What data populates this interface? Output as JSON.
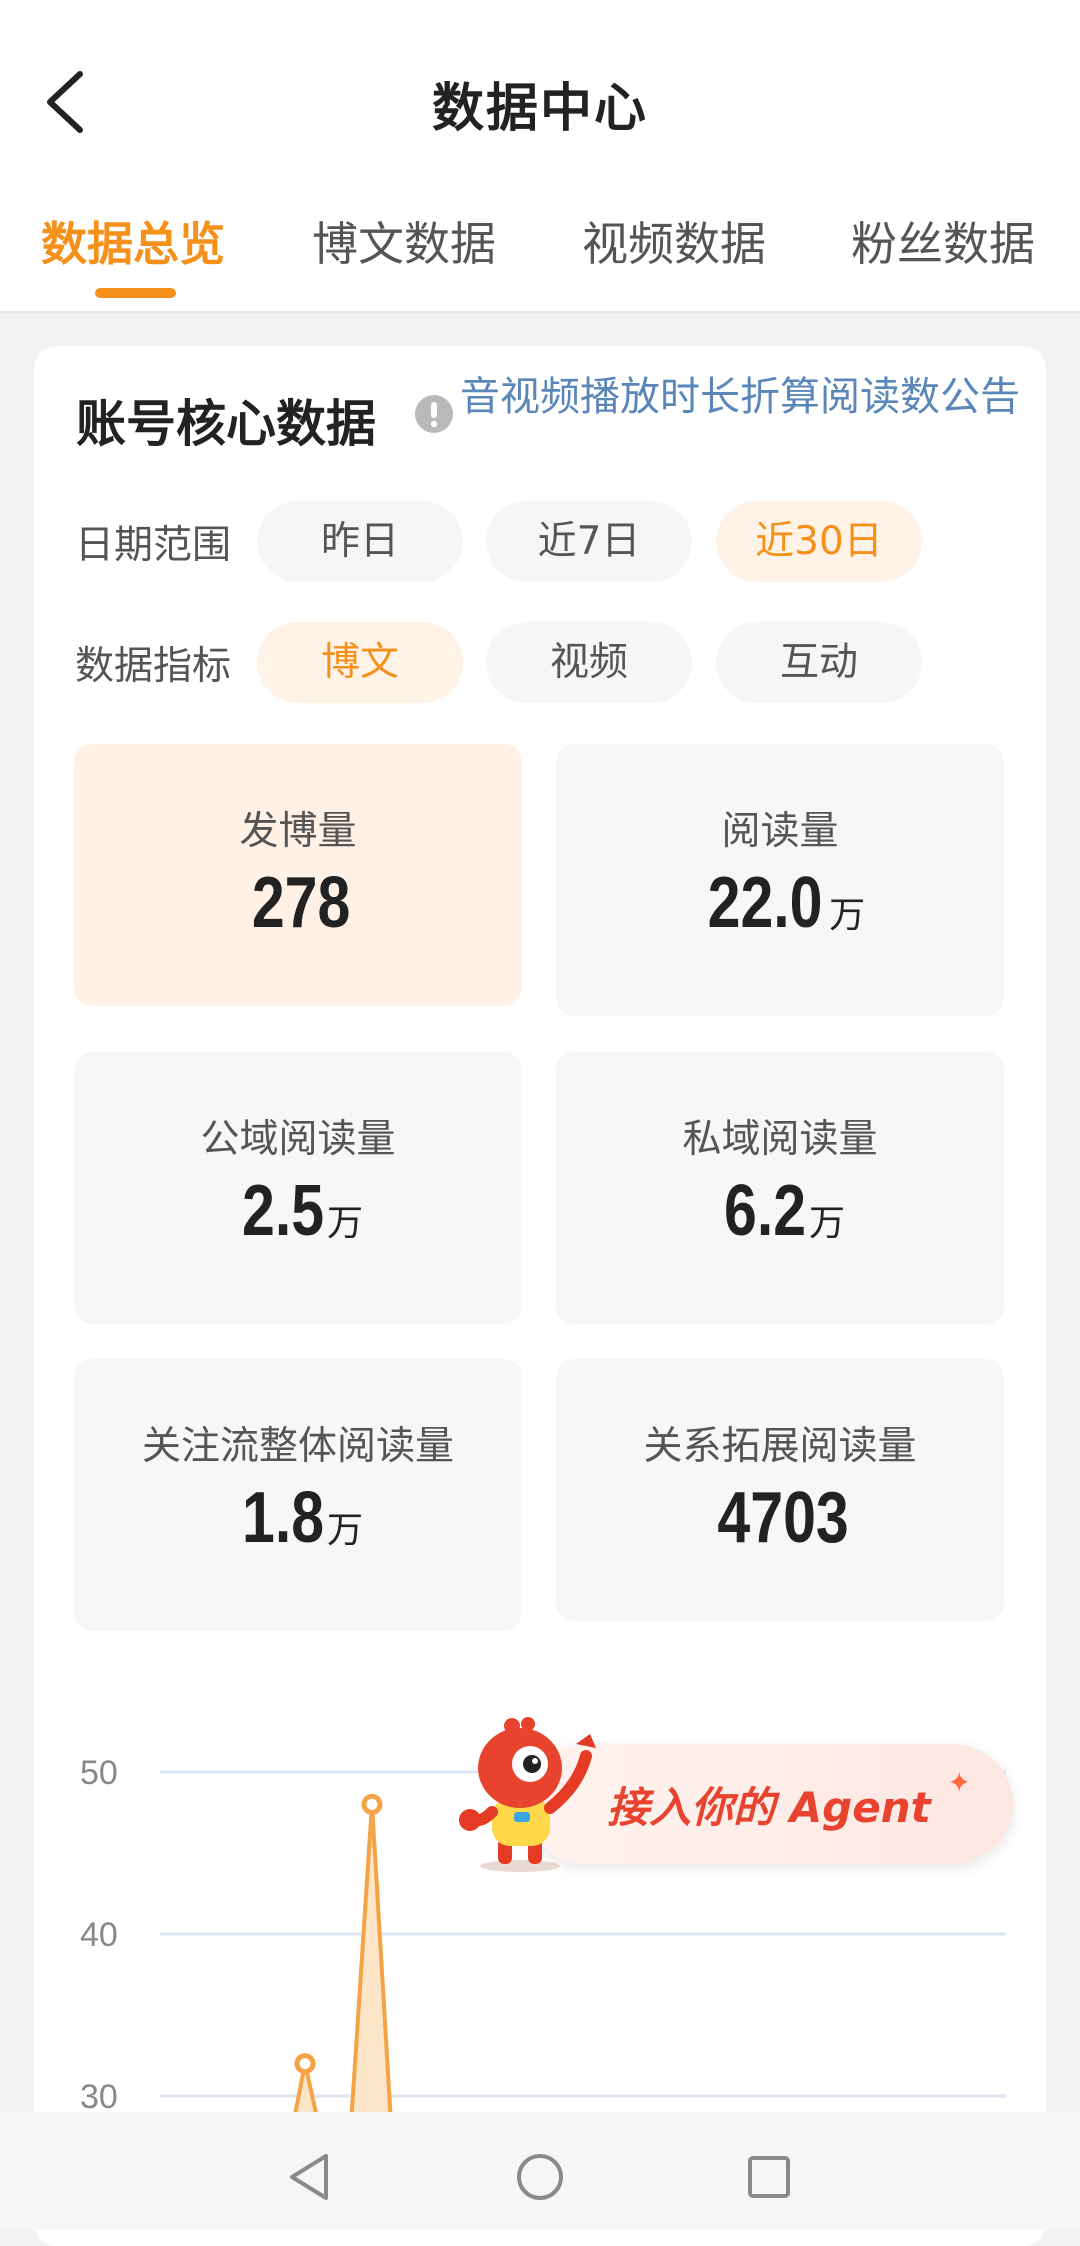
{
  "header": {
    "title": "数据中心",
    "tabs": [
      {
        "label": "数据总览",
        "active": true
      },
      {
        "label": "博文数据",
        "active": false
      },
      {
        "label": "视频数据",
        "active": false
      },
      {
        "label": "粉丝数据",
        "active": false
      }
    ]
  },
  "card": {
    "title": "账号核心数据",
    "notice_link": "音视频播放时长折算阅读数公告",
    "date_range": {
      "label": "日期范围",
      "options": [
        "昨日",
        "近7日",
        "近30日"
      ],
      "selected": "近30日"
    },
    "metric_type": {
      "label": "数据指标",
      "options": [
        "博文",
        "视频",
        "互动"
      ],
      "selected": "博文"
    },
    "metrics": [
      {
        "label": "发博量",
        "value": "278",
        "unit": ""
      },
      {
        "label": "阅读量",
        "value": "22.0",
        "unit": "万"
      },
      {
        "label": "公域阅读量",
        "value": "2.5",
        "unit": "万"
      },
      {
        "label": "私域阅读量",
        "value": "6.2",
        "unit": "万"
      },
      {
        "label": "关注流整体阅读量",
        "value": "1.8",
        "unit": "万"
      },
      {
        "label": "关系拓展阅读量",
        "value": "4703",
        "unit": ""
      }
    ]
  },
  "chart_data": {
    "type": "line",
    "y_ticks": [
      "50",
      "40",
      "30"
    ],
    "visible_points": [
      32,
      48
    ],
    "color": "#f5a347"
  },
  "agent_banner": {
    "text": "接入你的 Agent"
  },
  "colors": {
    "accent": "#f5901a",
    "link": "#5a86b8",
    "agent": "#e8432e"
  }
}
